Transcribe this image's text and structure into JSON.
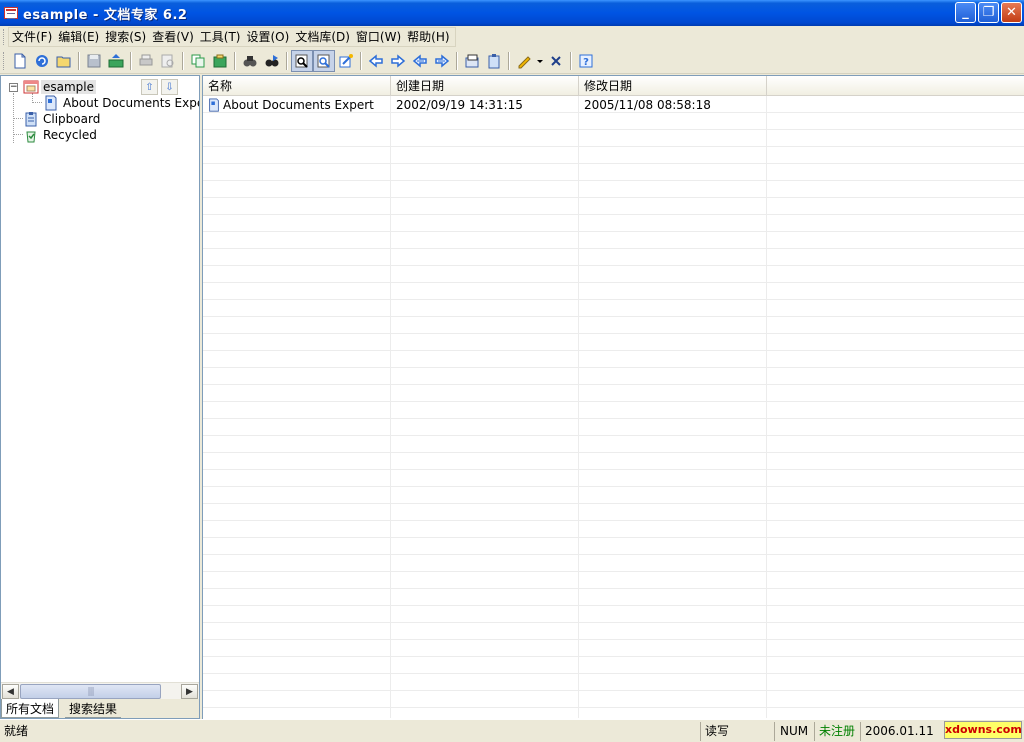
{
  "window": {
    "title": "esample - 文档专家  6.2",
    "minimize": "_",
    "restore": "❐",
    "close": "✕"
  },
  "menu": [
    "文件(F)",
    "编辑(E)",
    "搜索(S)",
    "查看(V)",
    "工具(T)",
    "设置(O)",
    "文档库(D)",
    "窗口(W)",
    "帮助(H)"
  ],
  "toolbar_icons": [
    "new-document-icon",
    "refresh-icon",
    "open-folder-icon",
    "save-icon",
    "export-icon",
    "print-icon",
    "print-preview-icon",
    "copy-icon",
    "paste-icon",
    "find-icon",
    "find-next-icon",
    "zoom-in-icon",
    "zoom-out-icon",
    "edit-link-icon",
    "back-icon",
    "forward-icon",
    "previous-icon",
    "next-icon",
    "properties-icon",
    "clipboard-icon",
    "pencil-icon",
    "delete-icon",
    "help-icon"
  ],
  "tree": {
    "root": "esample",
    "child": "About Documents Expert",
    "clipboard": "Clipboard",
    "recycled": "Recycled",
    "up_arrow": "⇧",
    "down_arrow": "⇩"
  },
  "scrollbar": {
    "left": "◀",
    "right": "▶",
    "thumb_grip": "|||"
  },
  "tabs": {
    "all": "所有文档",
    "search": "搜索结果"
  },
  "list": {
    "columns": [
      "名称",
      "创建日期",
      "修改日期"
    ],
    "rows": [
      {
        "name": "About Documents Expert",
        "created": "2002/09/19 14:31:15",
        "modified": "2005/11/08 08:58:18"
      }
    ]
  },
  "status": {
    "ready": "就绪",
    "readwrite": "读写",
    "num": "NUM",
    "unregistered": "未注册",
    "date": "2006.01.11",
    "watermark": "xdowns.com"
  },
  "colors": {
    "titlebar": "#0054e3",
    "selection": "#e4e4e4",
    "unregistered": "#008000",
    "watermark_bg": "#ffff66",
    "watermark_text": "#cc0000"
  }
}
